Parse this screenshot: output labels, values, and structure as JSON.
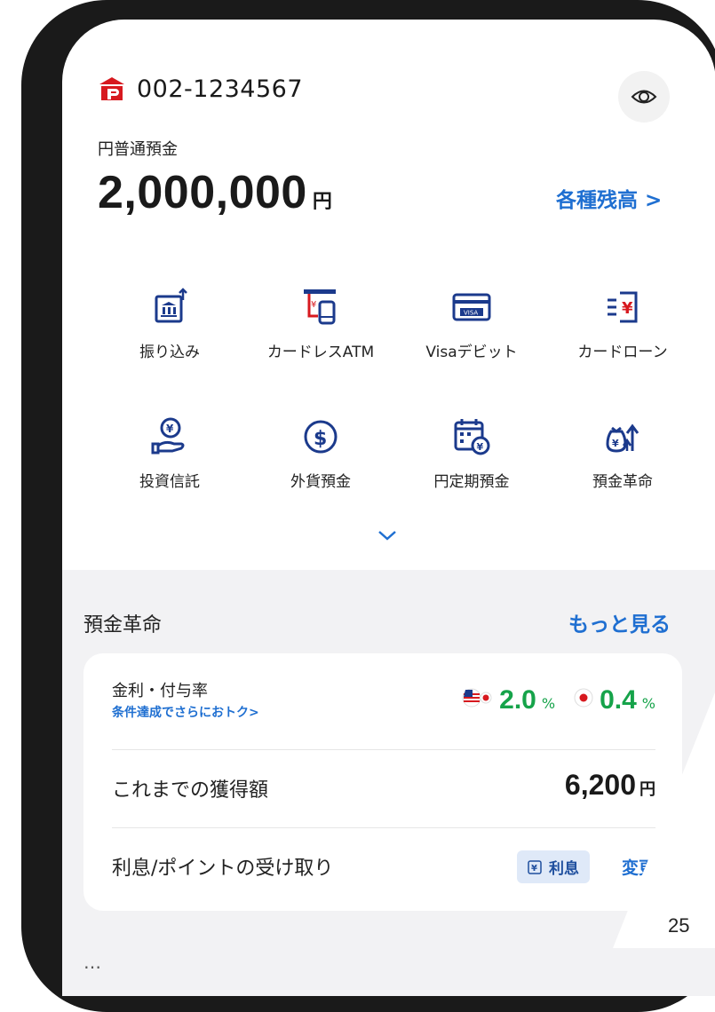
{
  "header": {
    "account_number": "002-1234567",
    "account_type": "円普通預金",
    "balance": "2,000,000",
    "balance_unit": "円",
    "balances_link": "各種残高 >"
  },
  "menu": [
    {
      "label": "振り込み",
      "icon": "bank-transfer-icon"
    },
    {
      "label": "カードレスATM",
      "icon": "cardless-atm-icon"
    },
    {
      "label": "Visaデビット",
      "icon": "visa-card-icon"
    },
    {
      "label": "カードローン",
      "icon": "card-loan-icon"
    },
    {
      "label": "投資信託",
      "icon": "investment-trust-icon"
    },
    {
      "label": "外貨預金",
      "icon": "dollar-coin-icon"
    },
    {
      "label": "円定期預金",
      "icon": "calendar-yen-icon"
    },
    {
      "label": "預金革命",
      "icon": "money-bag-growth-icon"
    }
  ],
  "section": {
    "title": "預金革命",
    "more_link": "もっと見る",
    "rate_label": "金利・付与率",
    "rate_sub": "条件達成でさらにおトク>",
    "rate_usd": "2.0",
    "rate_jpy": "0.4",
    "pct": "%",
    "earned_label": "これまでの獲得額",
    "earned_value": "6,200",
    "earned_unit": "円",
    "receive_label": "利息/ポイントの受け取り",
    "receive_tag": "利息",
    "receive_change": "変更",
    "next_title": "…"
  },
  "page_number": "25",
  "colors": {
    "accent": "#1f6fd1",
    "green": "#16a34a",
    "brand_red": "#d7191f",
    "icon_blue": "#1b3a8c"
  }
}
